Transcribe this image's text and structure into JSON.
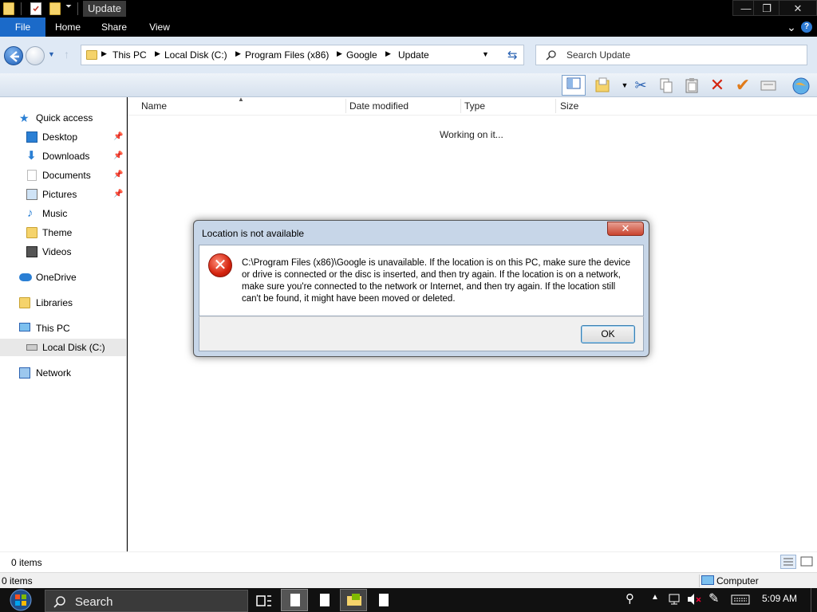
{
  "window": {
    "title": "Update",
    "minimize": "—",
    "maximize": "❐",
    "close": "✕"
  },
  "ribbon": {
    "tabs": [
      "File",
      "Home",
      "Share",
      "View"
    ],
    "expand": "⌄",
    "help": "?"
  },
  "address": {
    "segments": [
      "This PC",
      "Local Disk (C:)",
      "Program Files (x86)",
      "Google",
      "Update"
    ],
    "search_placeholder": "Search Update"
  },
  "nav": {
    "quick_access": "Quick access",
    "items": [
      {
        "label": "Desktop",
        "pinned": true
      },
      {
        "label": "Downloads",
        "pinned": true
      },
      {
        "label": "Documents",
        "pinned": true
      },
      {
        "label": "Pictures",
        "pinned": true
      },
      {
        "label": "Music",
        "pinned": false
      },
      {
        "label": "Theme",
        "pinned": false
      },
      {
        "label": "Videos",
        "pinned": false
      }
    ],
    "onedrive": "OneDrive",
    "libraries": "Libraries",
    "this_pc": "This PC",
    "local_disk": "Local Disk (C:)",
    "network": "Network"
  },
  "content": {
    "columns": [
      "Name",
      "Date modified",
      "Type",
      "Size"
    ],
    "status_message": "Working on it..."
  },
  "statusbar": {
    "items_top": "0 items",
    "items_bottom": "0 items",
    "computer": "Computer"
  },
  "dialog": {
    "title": "Location is not available",
    "close": "✕",
    "message": "C:\\Program Files (x86)\\Google is unavailable. If the location is on this PC, make sure the device or drive is connected or the disc is inserted, and then try again. If the location is on a network, make sure you're connected to the network or Internet, and then try again. If the location still can't be found, it might have been moved or deleted.",
    "ok": "OK"
  },
  "taskbar": {
    "search": "Search",
    "time": "5:09 AM"
  },
  "colors": {
    "accent": "#1b6ac9",
    "error": "#d4230e"
  }
}
